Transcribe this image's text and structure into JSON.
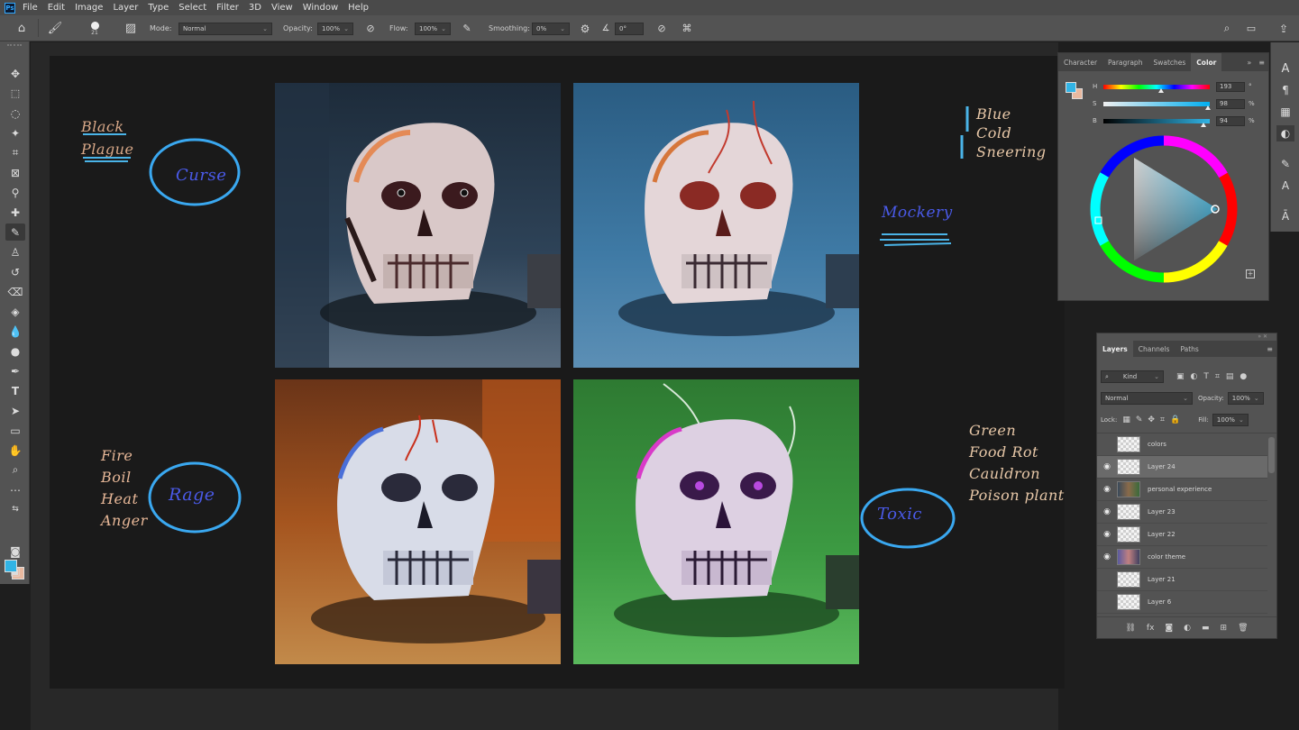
{
  "menu": [
    "File",
    "Edit",
    "Image",
    "Layer",
    "Type",
    "Select",
    "Filter",
    "3D",
    "View",
    "Window",
    "Help"
  ],
  "options": {
    "brush_size": "21",
    "mode_label": "Mode:",
    "mode_value": "Normal",
    "opacity_label": "Opacity:",
    "opacity_value": "100%",
    "flow_label": "Flow:",
    "flow_value": "100%",
    "smoothing_label": "Smoothing:",
    "smoothing_value": "0%",
    "angle_value": "0°"
  },
  "notes": {
    "black_plague": [
      "Black",
      "Plague"
    ],
    "curse": "Curse",
    "fire": [
      "Fire",
      "Boil",
      "Heat",
      "Anger"
    ],
    "rage": "Rage",
    "blue": [
      "Blue",
      "Cold",
      "Sneering"
    ],
    "mockery": "Mockery",
    "green": [
      "Green",
      "Food Rot",
      "Cauldron",
      "Poison plant"
    ],
    "toxic": "Toxic"
  },
  "color_panel": {
    "tabs": [
      "Character",
      "Paragraph",
      "Swatches",
      "Color"
    ],
    "active_tab": "Color",
    "h": {
      "label": "H",
      "value": "193",
      "unit": "°",
      "fraction": 0.54
    },
    "s": {
      "label": "S",
      "value": "98",
      "unit": "%",
      "fraction": 0.98
    },
    "b": {
      "label": "B",
      "value": "94",
      "unit": "%",
      "fraction": 0.94
    },
    "foreground_color": "#31b4e6",
    "background_color": "#e9b9a0"
  },
  "layers_panel": {
    "tabs": [
      "Layers",
      "Channels",
      "Paths"
    ],
    "filter_label": "Kind",
    "blend_mode": "Normal",
    "opacity_label": "Opacity:",
    "opacity_value": "100%",
    "lock_label": "Lock:",
    "fill_label": "Fill:",
    "fill_value": "100%",
    "layers": [
      {
        "name": "colors",
        "visible": false,
        "thumb": "blank"
      },
      {
        "name": "Layer 24",
        "visible": true,
        "thumb": "blank",
        "selected": true
      },
      {
        "name": "personal experience",
        "visible": true,
        "thumb": "img1"
      },
      {
        "name": "Layer 23",
        "visible": true,
        "thumb": "blank"
      },
      {
        "name": "Layer 22",
        "visible": true,
        "thumb": "blank"
      },
      {
        "name": "color theme",
        "visible": true,
        "thumb": "img2"
      },
      {
        "name": "Layer 21",
        "visible": false,
        "thumb": "blank"
      },
      {
        "name": "Layer 6",
        "visible": false,
        "thumb": "blank"
      }
    ]
  }
}
